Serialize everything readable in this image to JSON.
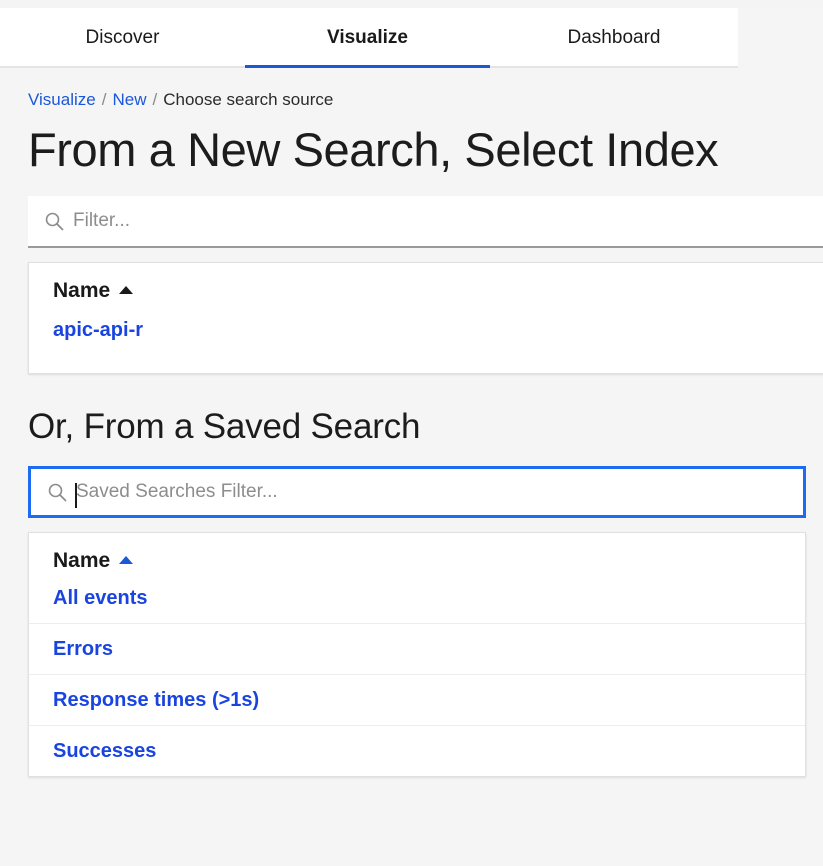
{
  "nav": {
    "tabs": [
      {
        "label": "Discover",
        "active": false
      },
      {
        "label": "Visualize",
        "active": true
      },
      {
        "label": "Dashboard",
        "active": false
      }
    ]
  },
  "breadcrumb": {
    "items": [
      {
        "label": "Visualize",
        "link": true
      },
      {
        "label": "New",
        "link": true
      },
      {
        "label": "Choose search source",
        "link": false
      }
    ],
    "separator": "/"
  },
  "new_search": {
    "title": "From a New Search, Select Index",
    "filter": {
      "placeholder": "Filter...",
      "value": "",
      "icon": "search-icon"
    },
    "table": {
      "column_header": "Name",
      "sort_direction": "asc",
      "sort_caret_color": "#1a1a1a",
      "rows": [
        {
          "name": "apic-api-r"
        }
      ]
    }
  },
  "saved_search": {
    "title": "Or, From a Saved Search",
    "filter": {
      "placeholder": "Saved Searches Filter...",
      "value": "",
      "icon": "search-icon",
      "focused": true
    },
    "table": {
      "column_header": "Name",
      "sort_direction": "asc",
      "sort_caret_color": "#1a58d8",
      "rows": [
        {
          "name": "All events"
        },
        {
          "name": "Errors"
        },
        {
          "name": "Response times (>1s)"
        },
        {
          "name": "Successes"
        }
      ]
    }
  },
  "colors": {
    "accent_blue": "#1a58d8",
    "link_blue": "#1a44e0",
    "focus_blue": "#1c6bf2",
    "page_background": "#f5f5f5",
    "panel_background": "#ffffff"
  }
}
